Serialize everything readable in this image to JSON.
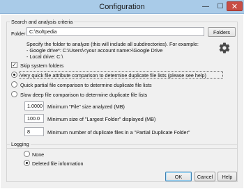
{
  "window": {
    "title": "Configuration",
    "controls": {
      "minimize": "—",
      "maximize": "☐",
      "close": "✕"
    }
  },
  "search_group": {
    "title": "Search and analysis criteria",
    "folder_label": "Folder",
    "folder_value": "C:\\Softpedia",
    "folders_button": "Folders",
    "help_lines": [
      "Specify the folder to analyze (this will include all subdirectories). For example:",
      "- Google drive*: C:\\Users\\<your account name>\\Google Drive",
      "- Local drive: C:\\"
    ],
    "settings_icon": "gear-icon",
    "skip_system_folders": {
      "label": "Skip system folders",
      "checked": true
    },
    "comparison_options": [
      {
        "label": "Very quick file attribute comparison to determine duplicate file lists (please see help)",
        "selected": true
      },
      {
        "label": "Quick partial file comparison to determine duplicate file lists",
        "selected": false
      },
      {
        "label": "Slow deep file comparison to determine duplicate file lists",
        "selected": false
      }
    ],
    "min_file_size": {
      "value": "1.0000",
      "label": "Minimum \"File\" size analyzed (MB)"
    },
    "min_largest_folder": {
      "value": "100.0",
      "label": "Minimum size of \"Largest Folder\" displayed (MB)"
    },
    "min_duplicates": {
      "value": "8",
      "label": "Minimum number of duplicate files in a \"Partial Duplicate Folder\""
    }
  },
  "logging_group": {
    "title": "Logging",
    "options": [
      {
        "label": "None",
        "selected": false
      },
      {
        "label": "Deleted file information",
        "selected": true
      }
    ]
  },
  "footer": {
    "ok": "OK",
    "cancel": "Cancel",
    "help": "Help"
  }
}
